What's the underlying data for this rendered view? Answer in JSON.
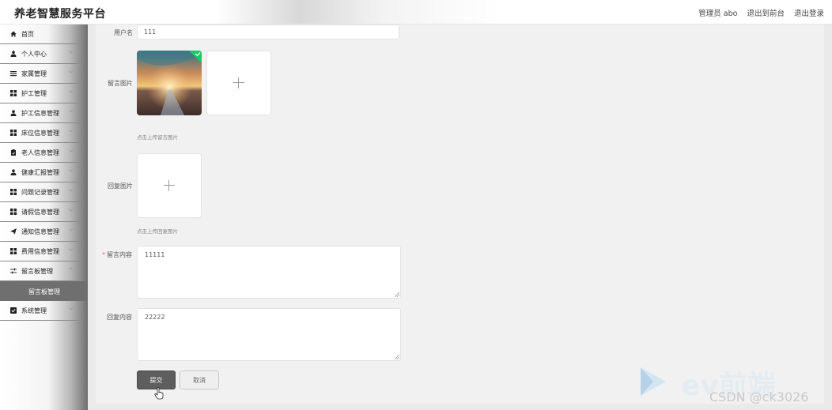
{
  "header": {
    "app_title": "养老智慧服务平台",
    "user_label": "管理员 abo",
    "front_link": "退出到前台",
    "logout_link": "退出登录"
  },
  "sidebar": {
    "items": [
      {
        "label": "首页",
        "icon": "home-icon"
      },
      {
        "label": "个人中心",
        "icon": "user-icon"
      },
      {
        "label": "家属管理",
        "icon": "list-icon"
      },
      {
        "label": "护工管理",
        "icon": "grid-icon"
      },
      {
        "label": "护工信息管理",
        "icon": "user-icon"
      },
      {
        "label": "床位信息管理",
        "icon": "grid-icon"
      },
      {
        "label": "老人信息管理",
        "icon": "clipboard-icon"
      },
      {
        "label": "健康汇报管理",
        "icon": "user-icon"
      },
      {
        "label": "问题记录管理",
        "icon": "grid-icon"
      },
      {
        "label": "请假信息管理",
        "icon": "grid-icon"
      },
      {
        "label": "通知信息管理",
        "icon": "send-icon"
      },
      {
        "label": "费用信息管理",
        "icon": "grid-icon"
      },
      {
        "label": "留言板管理",
        "icon": "sliders-icon"
      }
    ],
    "active_sub": "留言板管理",
    "last_item": {
      "label": "系统管理",
      "icon": "checkbox-icon"
    }
  },
  "form": {
    "username_label": "用户名",
    "username_value": "111",
    "message_image_label": "留言图片",
    "message_image_hint": "点击上传留言图片",
    "reply_image_label": "回复图片",
    "reply_image_hint": "点击上传回复图片",
    "message_content_label": "留言内容",
    "message_content_value": "11111",
    "reply_content_label": "回复内容",
    "reply_content_value": "22222",
    "submit_label": "提交",
    "cancel_label": "取消"
  },
  "watermark": {
    "brand_text": "ev前端",
    "csdn_text": "CSDN @ck3026"
  },
  "colors": {
    "primary_button": "#5e5e5e",
    "active_menu": "#6f6f6f",
    "required_star": "#f56c6c",
    "upload_success": "#13ce66"
  }
}
